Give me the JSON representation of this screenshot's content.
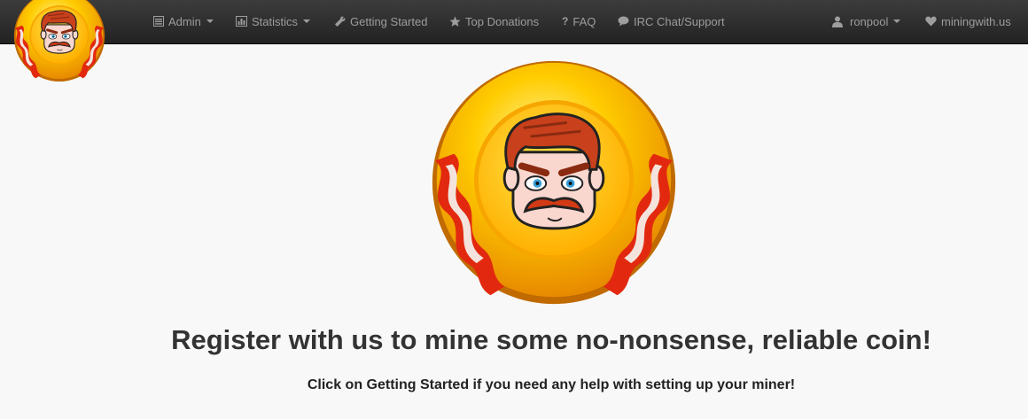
{
  "navbar": {
    "items": [
      {
        "label": "Admin",
        "icon": "list-icon",
        "dropdown": true
      },
      {
        "label": "Statistics",
        "icon": "bar-chart-icon",
        "dropdown": true
      },
      {
        "label": "Getting Started",
        "icon": "wrench-icon",
        "dropdown": false
      },
      {
        "label": "Top Donations",
        "icon": "star-icon",
        "dropdown": false
      },
      {
        "label": "FAQ",
        "icon": "question-icon",
        "dropdown": false
      },
      {
        "label": "IRC Chat/Support",
        "icon": "chat-bubble-icon",
        "dropdown": false
      }
    ],
    "user": {
      "label": "ronpool",
      "icon": "user-icon",
      "dropdown": true
    },
    "site": {
      "label": "miningwith.us",
      "icon": "heart-icon"
    }
  },
  "main": {
    "headline": "Register with us to mine some no-nonsense, reliable coin!",
    "subline": "Click on Getting Started if you need any help with setting up your miner!"
  },
  "colors": {
    "navbar_bg": "#222222",
    "nav_text": "#9d9d9d",
    "page_bg": "#f8f8f8",
    "coin_gold": "#ffc200",
    "bacon_red": "#e2290f"
  }
}
